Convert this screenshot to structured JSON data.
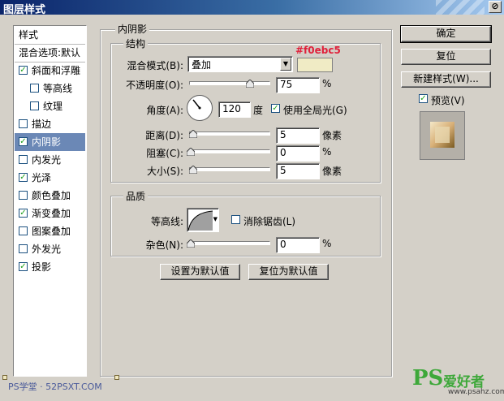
{
  "window": {
    "title": "图层样式",
    "close_label": "⊘"
  },
  "style_list": {
    "header": "样式",
    "blend_options": "混合选项:默认",
    "items": [
      {
        "label": "斜面和浮雕",
        "checked": true,
        "indent": false
      },
      {
        "label": "等高线",
        "checked": false,
        "indent": true
      },
      {
        "label": "纹理",
        "checked": false,
        "indent": true
      },
      {
        "label": "描边",
        "checked": false,
        "indent": false
      },
      {
        "label": "内阴影",
        "checked": true,
        "indent": false,
        "selected": true
      },
      {
        "label": "内发光",
        "checked": false,
        "indent": false
      },
      {
        "label": "光泽",
        "checked": true,
        "indent": false
      },
      {
        "label": "颜色叠加",
        "checked": false,
        "indent": false
      },
      {
        "label": "渐变叠加",
        "checked": true,
        "indent": false
      },
      {
        "label": "图案叠加",
        "checked": false,
        "indent": false
      },
      {
        "label": "外发光",
        "checked": false,
        "indent": false
      },
      {
        "label": "投影",
        "checked": true,
        "indent": false
      }
    ]
  },
  "panel": {
    "title": "内阴影",
    "structure": {
      "label": "结构",
      "blend_mode_label": "混合模式(B):",
      "blend_mode_value": "叠加",
      "color_hex": "#f0ebc5",
      "color_annotation": "#f0ebc5",
      "opacity_label": "不透明度(O):",
      "opacity_value": "75",
      "opacity_unit": "%",
      "opacity_fraction": 0.75,
      "angle_label": "角度(A):",
      "angle_value": "120",
      "angle_unit": "度",
      "global_light_label": "使用全局光(G)",
      "global_light_checked": true,
      "distance_label": "距离(D):",
      "distance_value": "5",
      "distance_unit": "像素",
      "choke_label": "阻塞(C):",
      "choke_value": "0",
      "choke_unit": "%",
      "size_label": "大小(S):",
      "size_value": "5",
      "size_unit": "像素"
    },
    "quality": {
      "label": "品质",
      "contour_label": "等高线:",
      "anti_alias_label": "消除锯齿(L)",
      "anti_alias_checked": false,
      "noise_label": "杂色(N):",
      "noise_value": "0",
      "noise_unit": "%"
    },
    "set_default_label": "设置为默认值",
    "reset_default_label": "复位为默认值"
  },
  "right_buttons": {
    "ok": "确定",
    "reset": "复位",
    "new_style": "新建样式(W)...",
    "preview_label": "预览(V)",
    "preview_checked": true
  },
  "watermarks": {
    "left": "PS学堂 · 52PSXT.COM",
    "right_logo": "PS",
    "right_cn": "爱好者",
    "right_url": "www.psahz.com"
  }
}
